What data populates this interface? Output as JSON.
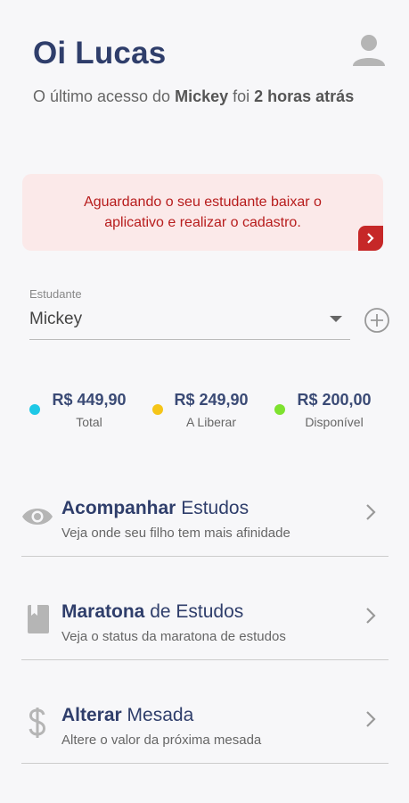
{
  "header": {
    "greeting": "Oi Lucas",
    "last_access_prefix": "O último acesso do ",
    "last_access_student": "Mickey",
    "last_access_middle": " foi ",
    "last_access_time": "2 horas atrás"
  },
  "alert": {
    "message": "Aguardando o seu estudante baixar o aplicativo e realizar o cadastro.",
    "color": "#c62828"
  },
  "student": {
    "label": "Estudante",
    "selected": "Mickey"
  },
  "balances": [
    {
      "value": "R$ 449,90",
      "label": "Total",
      "color": "#1ec8e6"
    },
    {
      "value": "R$ 249,90",
      "label": "A Liberar",
      "color": "#f5c518"
    },
    {
      "value": "R$ 200,00",
      "label": "Disponível",
      "color": "#7ee22f"
    }
  ],
  "menu": [
    {
      "title_bold": "Acompanhar",
      "title_rest": " Estudos",
      "subtitle": "Veja onde seu filho tem mais afinidade",
      "icon": "eye-icon"
    },
    {
      "title_bold": "Maratona",
      "title_rest": " de Estudos",
      "subtitle": "Veja o status da maratona de estudos",
      "icon": "book-icon"
    },
    {
      "title_bold": "Alterar",
      "title_rest": " Mesada",
      "subtitle": "Altere o valor da próxima mesada",
      "icon": "dollar-icon"
    }
  ]
}
